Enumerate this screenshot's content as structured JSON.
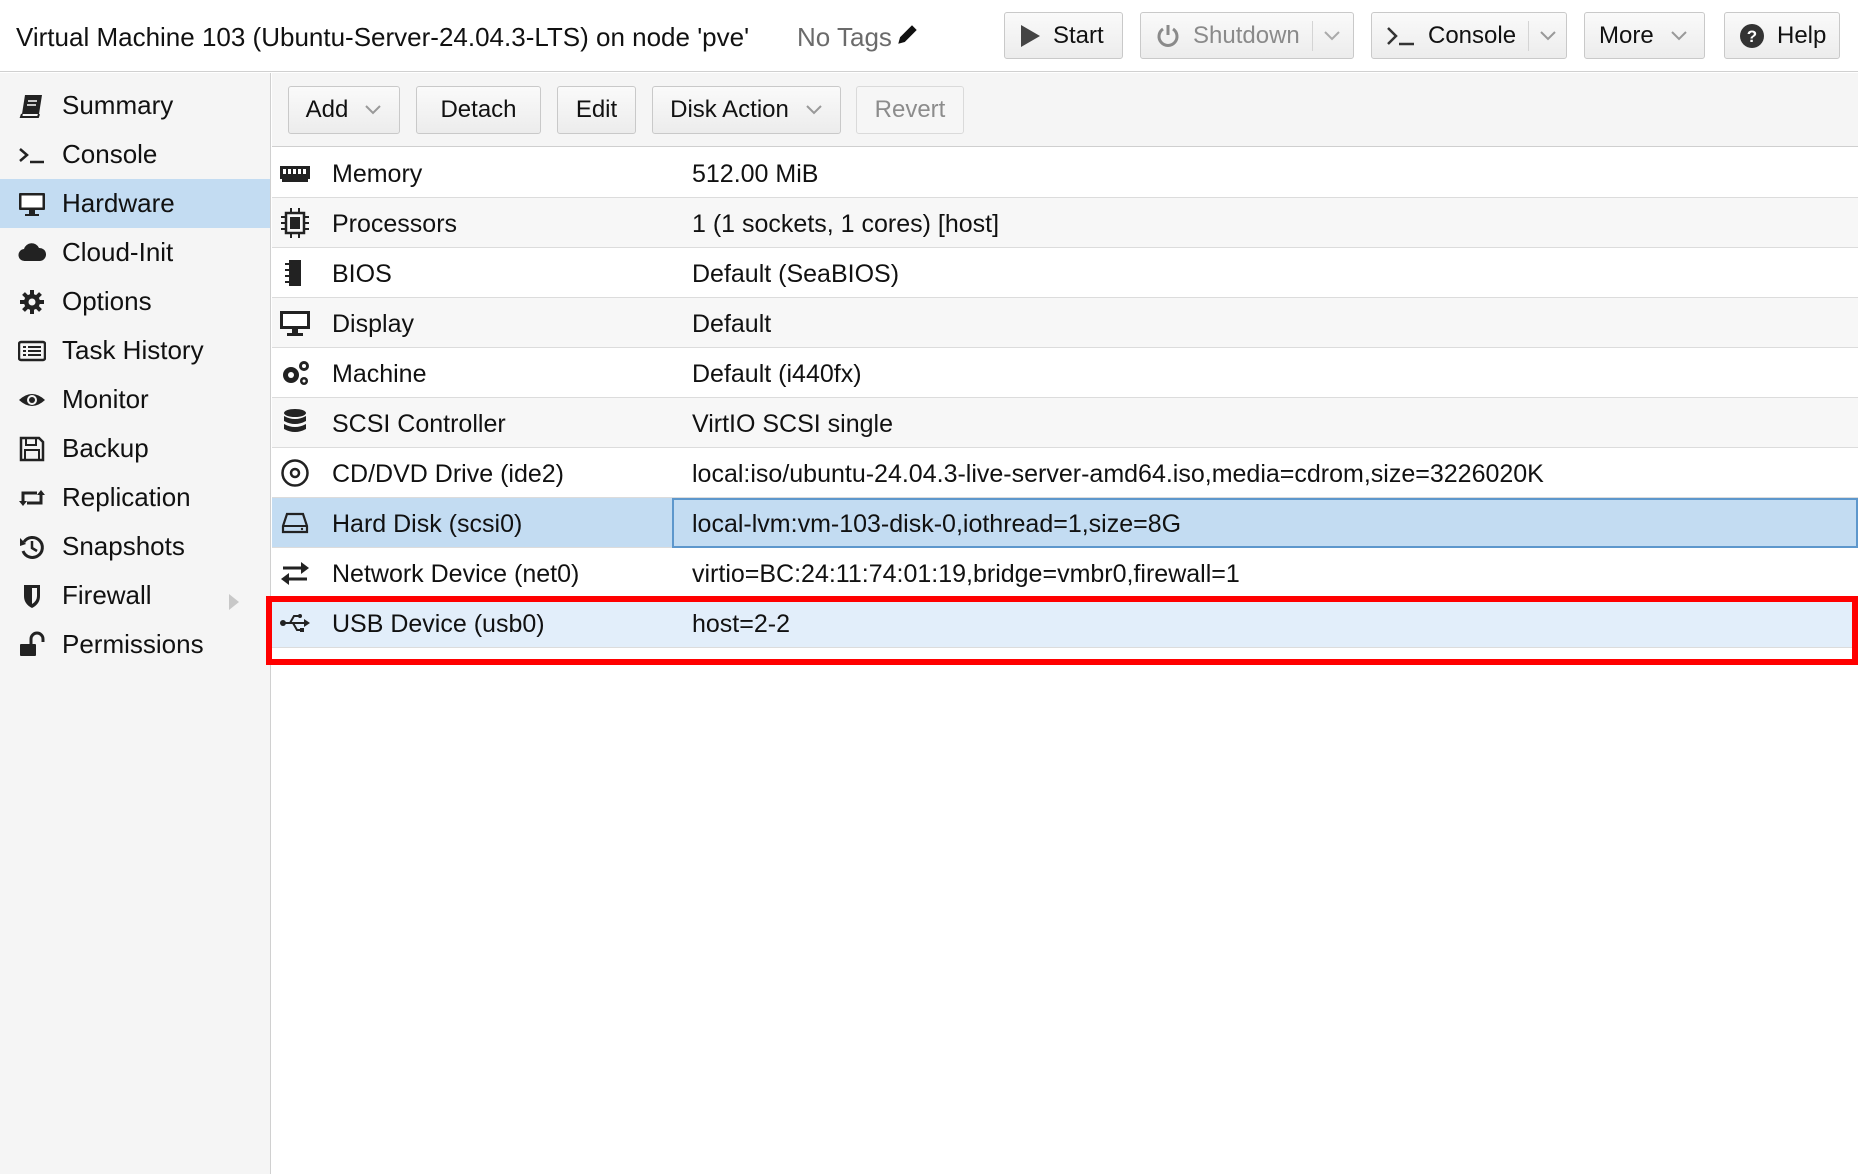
{
  "header": {
    "title": "Virtual Machine 103 (Ubuntu-Server-24.04.3-LTS) on node 'pve'",
    "tags_label": "No Tags",
    "buttons": {
      "start": "Start",
      "shutdown": "Shutdown",
      "console": "Console",
      "more": "More",
      "help": "Help"
    }
  },
  "sidebar": {
    "items": [
      {
        "label": "Summary",
        "icon": "book-icon"
      },
      {
        "label": "Console",
        "icon": "terminal-icon"
      },
      {
        "label": "Hardware",
        "icon": "monitor-icon",
        "active": true
      },
      {
        "label": "Cloud-Init",
        "icon": "cloud-icon"
      },
      {
        "label": "Options",
        "icon": "gear-icon"
      },
      {
        "label": "Task History",
        "icon": "list-icon"
      },
      {
        "label": "Monitor",
        "icon": "eye-icon"
      },
      {
        "label": "Backup",
        "icon": "floppy-icon"
      },
      {
        "label": "Replication",
        "icon": "retweet-icon"
      },
      {
        "label": "Snapshots",
        "icon": "history-icon"
      },
      {
        "label": "Firewall",
        "icon": "shield-icon"
      },
      {
        "label": "Permissions",
        "icon": "unlock-icon"
      }
    ]
  },
  "toolbar": {
    "add": "Add",
    "detach": "Detach",
    "edit": "Edit",
    "disk_action": "Disk Action",
    "revert": "Revert"
  },
  "hardware": [
    {
      "icon": "memory-icon",
      "name": "Memory",
      "value": "512.00 MiB"
    },
    {
      "icon": "cpu-icon",
      "name": "Processors",
      "value": "1 (1 sockets, 1 cores) [host]"
    },
    {
      "icon": "chip-icon",
      "name": "BIOS",
      "value": "Default (SeaBIOS)"
    },
    {
      "icon": "desktop-icon",
      "name": "Display",
      "value": "Default"
    },
    {
      "icon": "cogs-icon",
      "name": "Machine",
      "value": "Default (i440fx)"
    },
    {
      "icon": "database-icon",
      "name": "SCSI Controller",
      "value": "VirtIO SCSI single"
    },
    {
      "icon": "cdrom-icon",
      "name": "CD/DVD Drive (ide2)",
      "value": "local:iso/ubuntu-24.04.3-live-server-amd64.iso,media=cdrom,size=3226020K"
    },
    {
      "icon": "hdd-icon",
      "name": "Hard Disk (scsi0)",
      "value": "local-lvm:vm-103-disk-0,iothread=1,size=8G",
      "selected": true
    },
    {
      "icon": "exchange-icon",
      "name": "Network Device (net0)",
      "value": "virtio=BC:24:11:74:01:19,bridge=vmbr0,firewall=1"
    },
    {
      "icon": "usb-icon",
      "name": "USB Device (usb0)",
      "value": "host=2-2",
      "highlighted": true
    }
  ],
  "colors": {
    "selection": "#c3dcf2",
    "highlight_border": "#ff0000",
    "sidebar_bg": "#f5f5f5"
  }
}
